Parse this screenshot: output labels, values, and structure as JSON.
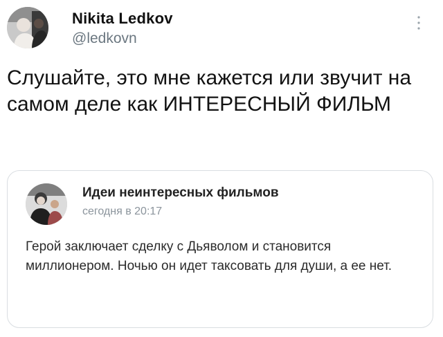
{
  "tweet": {
    "display_name": "Nikita Ledkov",
    "handle": "@ledkovn",
    "text": "Слушайте, это мне кажется или звучит на самом деле как ИНТЕРЕСНЫЙ ФИЛЬМ",
    "avatar_icon": "user-photo-avatar",
    "more_icon": "more-vertical-icon"
  },
  "quote": {
    "author": "Идеи неинтересных фильмов",
    "time": "сегодня в 20:17",
    "text": "Герой заключает сделку с Дьяволом и становится миллионером. Ночью он идет таксовать для души, а ее нет.",
    "avatar_icon": "group-photo-avatar"
  },
  "colors": {
    "text": "#0f1419",
    "secondary": "#6b7780",
    "border": "#d9dde1"
  }
}
